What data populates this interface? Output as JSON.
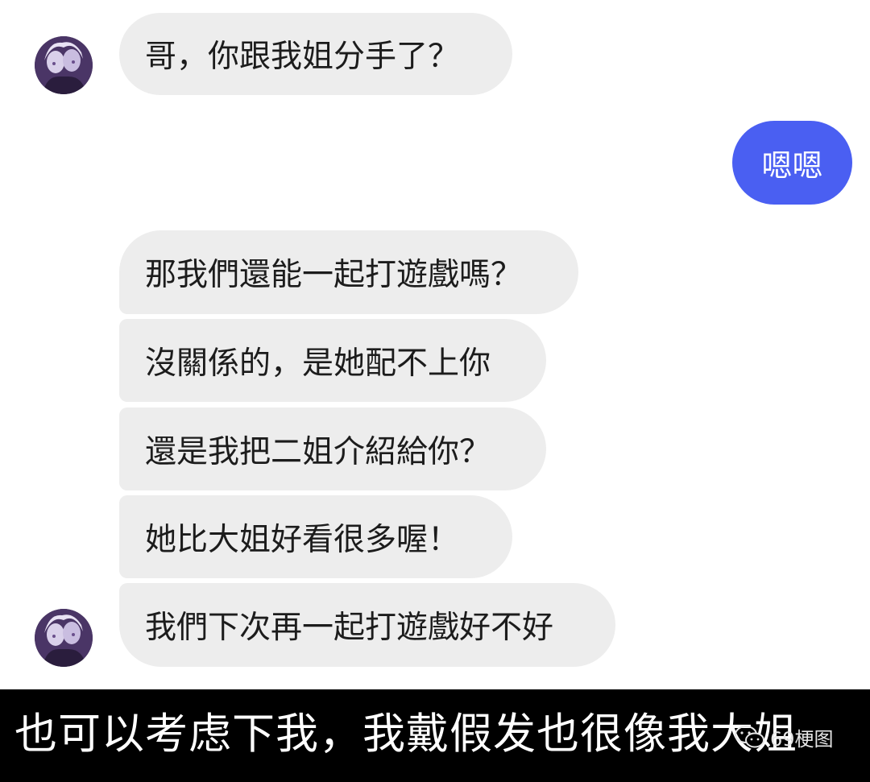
{
  "chat": {
    "messages": [
      {
        "side": "incoming",
        "text": "哥，你跟我姐分手了？"
      },
      {
        "side": "outgoing",
        "text": "嗯嗯"
      },
      {
        "side": "incoming",
        "text": "那我們還能一起打遊戲嗎？"
      },
      {
        "side": "incoming",
        "text": "沒關係的，是她配不上你"
      },
      {
        "side": "incoming",
        "text": "還是我把二姐介紹給你？"
      },
      {
        "side": "incoming",
        "text": "她比大姐好看很多喔！"
      },
      {
        "side": "incoming",
        "text": "我們下次再一起打遊戲好不好"
      }
    ]
  },
  "caption": {
    "text": "也可以考虑下我，我戴假发也很像我大姐"
  },
  "watermark": {
    "text": "69梗图",
    "icon": "wechat-icon"
  },
  "colors": {
    "incoming_bubble": "#ededed",
    "outgoing_bubble": "#4a5ff2",
    "caption_bg": "#000000"
  }
}
